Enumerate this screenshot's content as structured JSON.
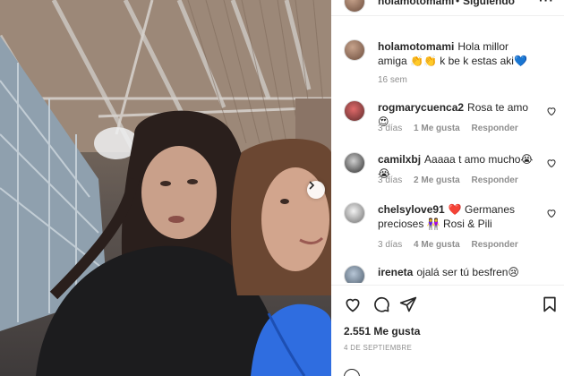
{
  "header": {
    "username": "holamotomami",
    "dot": "•",
    "follow_label": "Siguiendo",
    "more": "···"
  },
  "caption": {
    "username": "holamotomami",
    "text": "Hola millor amiga 👏👏 k be k estas aki💙",
    "time": "16 sem"
  },
  "comments": [
    {
      "username": "rogmarycuenca2",
      "text": "Rosa te amo 😍",
      "time": "3 días",
      "likes": "1 Me gusta",
      "reply": "Responder"
    },
    {
      "username": "camilxbj",
      "text": "Aaaaa t amo mucho😭😭",
      "time": "3 días",
      "likes": "2 Me gusta",
      "reply": "Responder"
    },
    {
      "username": "chelsylove91",
      "text": "❤️ Germanes precioses 👭 Rosi & Pili",
      "time": "3 días",
      "likes": "4 Me gusta",
      "reply": "Responder"
    },
    {
      "username": "ireneta",
      "text": "ojalá ser tú besfren😢",
      "time": "",
      "likes": "",
      "reply": ""
    }
  ],
  "post": {
    "likes_count": "2.551 Me gusta",
    "date": "4 DE SEPTIEMBRE"
  },
  "icons": {
    "like": "heart-icon",
    "comment": "comment-icon",
    "share": "share-icon",
    "save": "bookmark-icon",
    "carousel_next": "chevron-right-icon"
  },
  "colors": {
    "text": "#262626",
    "muted": "#8e8e8e",
    "divider": "#efefef",
    "scarf_blue": "#2f6de0"
  }
}
